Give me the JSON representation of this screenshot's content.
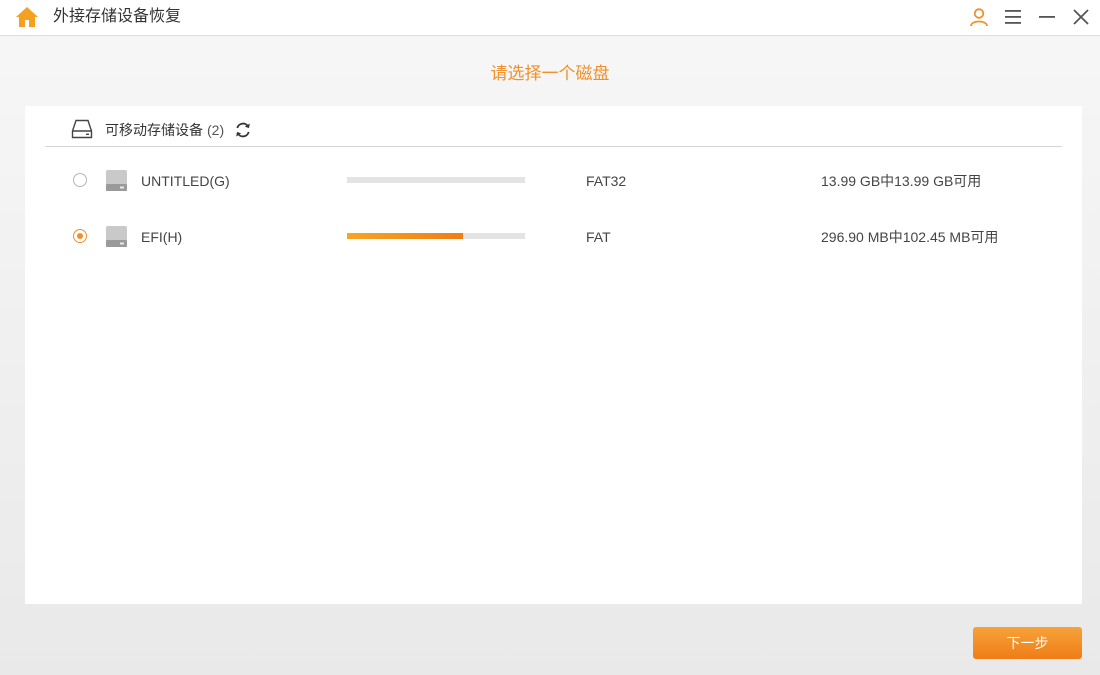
{
  "window": {
    "title": "外接存储设备恢复",
    "icons": [
      "home-icon",
      "user-icon",
      "menu-icon",
      "minimize-icon",
      "close-icon"
    ]
  },
  "page": {
    "heading": "请选择一个磁盘"
  },
  "section": {
    "title": "可移动存储设备",
    "count": "(2)",
    "icons": [
      "drive-outline-icon",
      "refresh-icon"
    ]
  },
  "disks": [
    {
      "name": "UNTITLED(G)",
      "filesystem": "FAT32",
      "space": "13.99 GB中13.99 GB可用",
      "used_fraction": 0.0,
      "selected": false
    },
    {
      "name": "EFI(H)",
      "filesystem": "FAT",
      "space": "296.90 MB中102.45 MB可用",
      "used_fraction": 0.65,
      "selected": true
    }
  ],
  "actions": {
    "next_label": "下一步"
  },
  "colors": {
    "accent": "#f0902a",
    "accent_dark": "#ef7d16",
    "panel_bg": "#ffffff",
    "page_bg": "#efefef"
  }
}
